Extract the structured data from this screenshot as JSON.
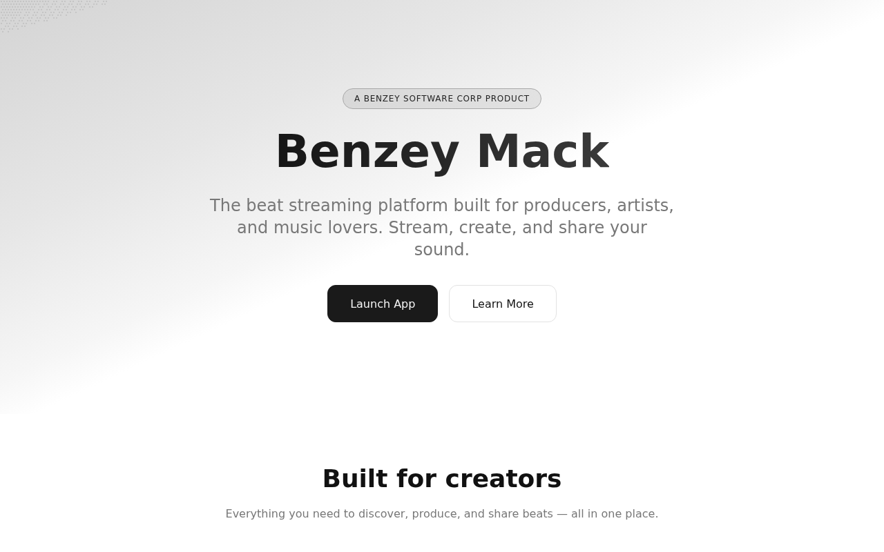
{
  "hero": {
    "badge": "A BENZEY SOFTWARE CORP PRODUCT",
    "title": "Benzey Mack",
    "tagline": "The beat streaming platform built for producers, artists, and music lovers. Stream, create, and share your sound.",
    "buttons": [
      {
        "label": "Launch App",
        "kind": "primary"
      },
      {
        "label": "Learn More",
        "kind": "secondary"
      }
    ]
  },
  "features_section": {
    "heading": "Built for creators",
    "subheading": "Everything you need to discover, produce, and share beats — all in one place."
  }
}
